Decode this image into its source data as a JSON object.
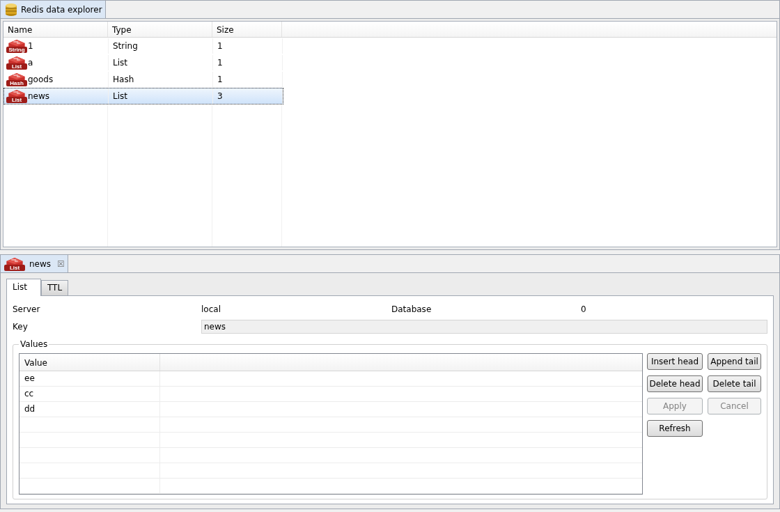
{
  "explorer": {
    "title": "Redis data explorer",
    "selected": true,
    "columns": [
      "Name",
      "Type",
      "Size"
    ],
    "rows": [
      {
        "icon_label": "String",
        "name": "1",
        "type": "String",
        "size": "1",
        "selected": false
      },
      {
        "icon_label": "List",
        "name": "a",
        "type": "List",
        "size": "1",
        "selected": false
      },
      {
        "icon_label": "Hash",
        "name": "goods",
        "type": "Hash",
        "size": "1",
        "selected": false
      },
      {
        "icon_label": "List",
        "name": "news",
        "type": "List",
        "size": "3",
        "selected": true
      }
    ]
  },
  "editor": {
    "tab": {
      "icon_label": "List",
      "title": "news",
      "close": "☒"
    },
    "subtabs": [
      {
        "label": "List",
        "selected": true
      },
      {
        "label": "TTL",
        "selected": false
      }
    ],
    "server_label": "Server",
    "server": "local",
    "database_label": "Database",
    "database": "0",
    "key_label": "Key",
    "key": "news",
    "values_group": "Values",
    "values_column": "Value",
    "values": [
      "ee",
      "cc",
      "dd"
    ],
    "buttons": [
      {
        "label": "Insert head",
        "disabled": false
      },
      {
        "label": "Append tail",
        "disabled": false
      },
      {
        "label": "Delete head",
        "disabled": false
      },
      {
        "label": "Delete tail",
        "disabled": false
      },
      {
        "label": "Apply",
        "disabled": true
      },
      {
        "label": "Cancel",
        "disabled": true
      },
      {
        "label": "Refresh",
        "disabled": false
      }
    ]
  }
}
